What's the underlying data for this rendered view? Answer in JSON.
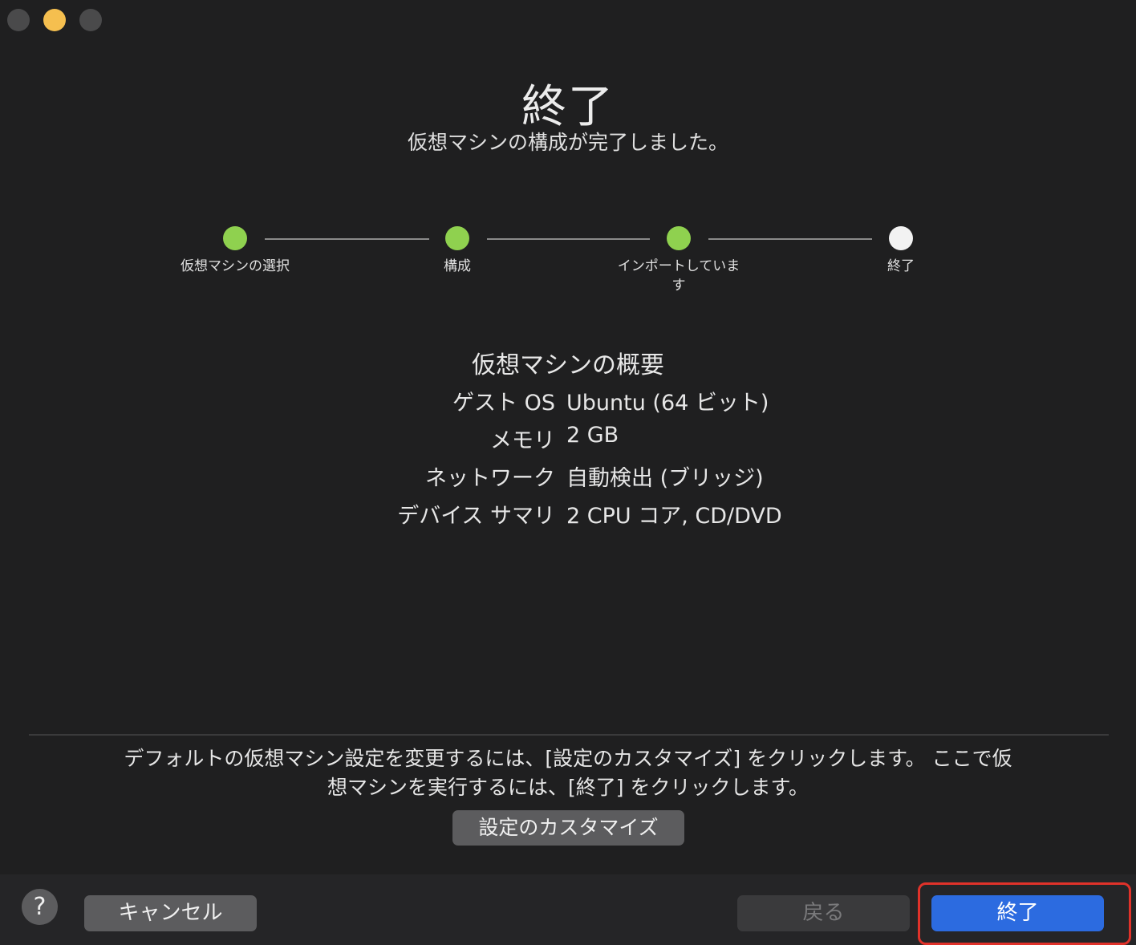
{
  "window": {
    "controls": {
      "close_icon": "close-icon",
      "minimize_icon": "minimize-icon",
      "zoom_icon": "zoom-icon"
    }
  },
  "header": {
    "title": "終了",
    "subtitle": "仮想マシンの構成が完了しました。"
  },
  "stepper": {
    "colors": {
      "done": "#8fd14f",
      "current": "#f2f2f2",
      "line": "#8a8a8a"
    },
    "steps": [
      {
        "label": "仮想マシンの選択",
        "state": "done"
      },
      {
        "label": "構成",
        "state": "done"
      },
      {
        "label": "インポートしています",
        "state": "done"
      },
      {
        "label": "終了",
        "state": "current"
      }
    ]
  },
  "summary": {
    "title": "仮想マシンの概要",
    "rows": [
      {
        "key": "ゲスト OS",
        "value": "Ubuntu (64 ビット)"
      },
      {
        "key": "メモリ",
        "value": "2 GB"
      },
      {
        "key": "ネットワーク",
        "value": "自動検出 (ブリッジ)"
      },
      {
        "key": "デバイス サマリ",
        "value": "2 CPU コア, CD/DVD"
      }
    ]
  },
  "hint": {
    "line1": "デフォルトの仮想マシン設定を変更するには、[設定のカスタマイズ] をクリックします。 ここで仮",
    "line2": "想マシンを実行するには、[終了] をクリックします。"
  },
  "buttons": {
    "customize_label": "設定のカスタマイズ",
    "help_label": "?",
    "cancel_label": "キャンセル",
    "back_label": "戻る",
    "finish_label": "終了"
  },
  "colors": {
    "background": "#1f1f20",
    "primary": "#2c6be0",
    "highlight": "#e0322a"
  }
}
